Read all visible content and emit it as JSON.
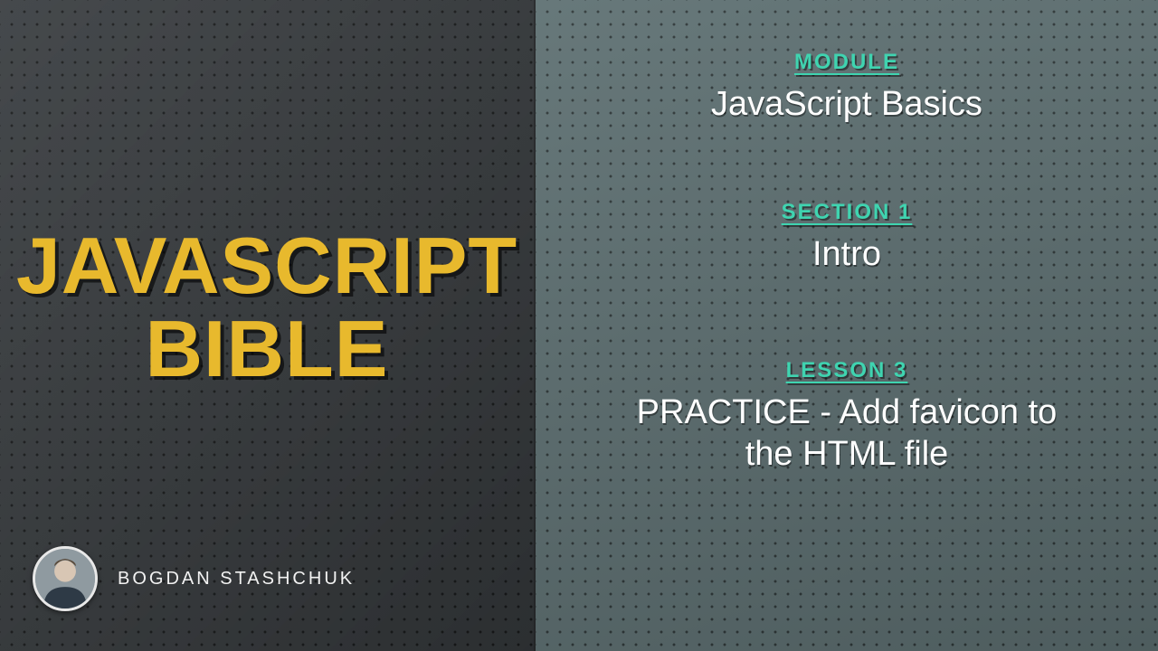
{
  "title_line1": "JAVASCRIPT",
  "title_line2": "BIBLE",
  "author": "BOGDAN STASHCHUK",
  "module": {
    "label": "MODULE",
    "value": "JavaScript Basics"
  },
  "section": {
    "label": "SECTION 1",
    "value": "Intro"
  },
  "lesson": {
    "label": "LESSON 3",
    "value": "PRACTICE - Add favicon to the HTML file"
  },
  "colors": {
    "accent_yellow": "#e8b92d",
    "accent_teal": "#3fd4b0",
    "left_bg": "#3a3e41",
    "right_bg": "#5f7173"
  }
}
